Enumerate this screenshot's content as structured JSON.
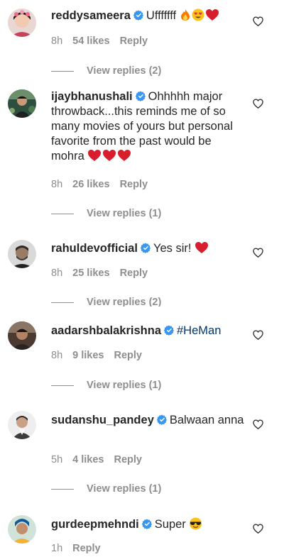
{
  "comments": [
    {
      "username": "reddysameera",
      "text": "Ufffffff",
      "emojis": [
        "fire",
        "heart-eyes",
        "red-heart"
      ],
      "time": "8h",
      "likes": "54 likes",
      "reply": "Reply",
      "view_replies": "View replies (2)"
    },
    {
      "username": "ijaybhanushali",
      "text": "Ohhhhh major throwback...this reminds me of so many movies of yours but personal favorite from the past would be mohra",
      "emojis": [
        "red-heart",
        "red-heart",
        "red-heart"
      ],
      "time": "8h",
      "likes": "26 likes",
      "reply": "Reply",
      "view_replies": "View replies (1)"
    },
    {
      "username": "rahuldevofficial",
      "text": "Yes sir!",
      "emojis": [
        "red-heart"
      ],
      "time": "8h",
      "likes": "25 likes",
      "reply": "Reply",
      "view_replies": "View replies (2)"
    },
    {
      "username": "aadarshbalakrishna",
      "text": "#HeMan",
      "emojis": [],
      "time": "8h",
      "likes": "9 likes",
      "reply": "Reply",
      "view_replies": "View replies (1)"
    },
    {
      "username": "sudanshu_pandey",
      "text": "Balwaan anna",
      "emojis": [],
      "time": "5h",
      "likes": "4 likes",
      "reply": "Reply",
      "view_replies": "View replies (1)"
    },
    {
      "username": "gurdeepmehndi",
      "text": "Super",
      "emojis": [
        "sunglasses-face"
      ],
      "time": "1h",
      "likes": "",
      "reply": "Reply",
      "view_replies": ""
    }
  ],
  "colors": {
    "text": "#262626",
    "secondary": "#8e8e8e",
    "verified": "#3897f0",
    "hashtag": "#00376b",
    "heart": "#ed4956"
  },
  "icons": {
    "verified": "verified-badge-icon",
    "like": "heart-outline-icon"
  }
}
